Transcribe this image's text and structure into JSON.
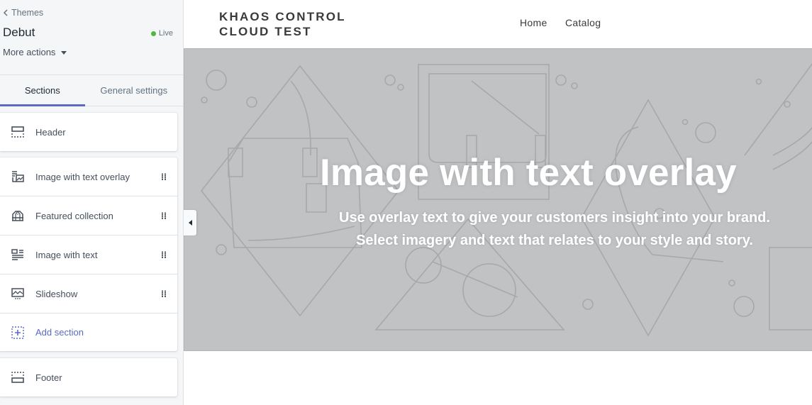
{
  "sidebar": {
    "back_label": "Themes",
    "theme_name": "Debut",
    "status": {
      "label": "Live",
      "color": "#50b83c"
    },
    "more_actions_label": "More actions",
    "tabs": [
      {
        "label": "Sections",
        "active": true
      },
      {
        "label": "General settings",
        "active": false
      }
    ],
    "header_section": {
      "label": "Header",
      "icon": "header-layout-icon"
    },
    "sections": [
      {
        "label": "Image with text overlay",
        "icon": "image-text-overlay-icon"
      },
      {
        "label": "Featured collection",
        "icon": "featured-collection-icon"
      },
      {
        "label": "Image with text",
        "icon": "image-with-text-icon"
      },
      {
        "label": "Slideshow",
        "icon": "slideshow-icon"
      }
    ],
    "add_section_label": "Add section",
    "footer_section": {
      "label": "Footer",
      "icon": "footer-layout-icon"
    },
    "accent_color": "#5c6ac4"
  },
  "preview": {
    "store_name_line1": "KHAOS CONTROL",
    "store_name_line2": "CLOUD TEST",
    "nav": [
      {
        "label": "Home"
      },
      {
        "label": "Catalog"
      }
    ],
    "hero": {
      "title": "Image with text overlay",
      "subtitle_line1": "Use overlay text to give your customers insight into your brand.",
      "subtitle_line2": "Select imagery and text that relates to your style and story."
    }
  }
}
